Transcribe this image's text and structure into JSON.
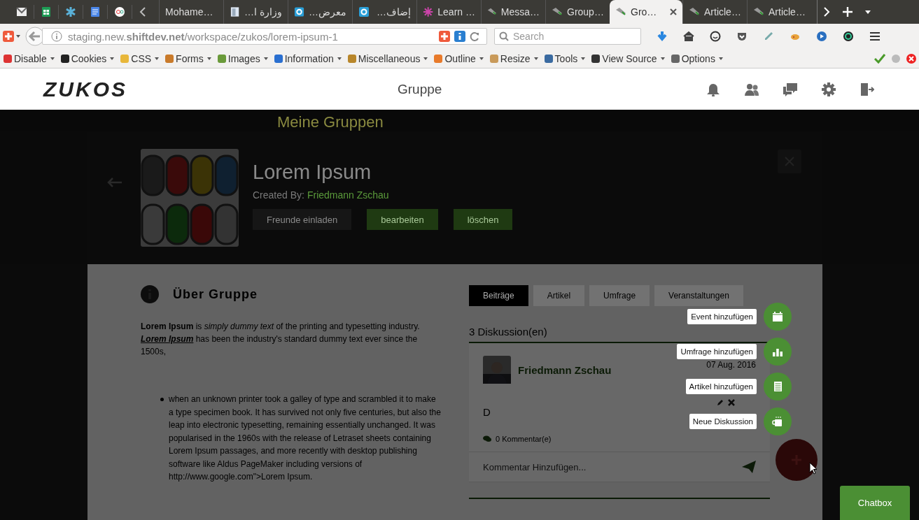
{
  "browser": {
    "pinned_tabs": [
      {
        "kind": "mail"
      },
      {
        "kind": "sheet"
      },
      {
        "kind": "asterisk"
      },
      {
        "kind": "docs"
      },
      {
        "kind": "olx"
      }
    ],
    "tabs": [
      {
        "label": "Mohame…",
        "kind": "none",
        "selected": false
      },
      {
        "label": "وزارة ا…",
        "kind": "doc",
        "selected": false
      },
      {
        "label": "معرض…",
        "kind": "circle",
        "selected": false
      },
      {
        "label": "إضاف…",
        "kind": "circle",
        "selected": false
      },
      {
        "label": "Learn …",
        "kind": "star",
        "selected": false
      },
      {
        "label": "Messa…",
        "kind": "site",
        "selected": false
      },
      {
        "label": "Group…",
        "kind": "site",
        "selected": false
      },
      {
        "label": "Gro…",
        "kind": "site",
        "selected": true
      },
      {
        "label": "Article…",
        "kind": "site",
        "selected": false
      },
      {
        "label": "Article…",
        "kind": "site",
        "selected": false
      }
    ],
    "url": "staging.new.**shiftdev.net**/workspace/zukos/lorem-ipsum-1",
    "search": {
      "placeholder": "Search"
    },
    "dev_toolbar": [
      "Disable",
      "Cookies",
      "CSS",
      "Forms",
      "Images",
      "Information",
      "Miscellaneous",
      "Outline",
      "Resize",
      "Tools",
      "View Source",
      "Options"
    ]
  },
  "app": {
    "logo": "ZUKOS",
    "title": "Gruppe"
  },
  "background_heading": "Meine Gruppen",
  "group": {
    "title": "Lorem Ipsum",
    "created_by_label": "Created By:",
    "creator": "Friedmann Zschau",
    "buttons": [
      {
        "label": "Freunde einladen",
        "kind": "plain"
      },
      {
        "label": "bearbeiten",
        "kind": "green"
      },
      {
        "label": "löschen",
        "kind": "green"
      }
    ]
  },
  "about": {
    "heading": "Über Gruppe",
    "intro": "**Lorem Ipsum** is *simply dummy text* of the printing and typesetting industry.",
    "link": "Lorem Ipsum",
    "after_link": "has been the industry's standard dummy text ever since the 1500s,",
    "bullets": [
      "when an unknown printer took a galley of type and scrambled it to make a type specimen book. It has survived not only five centuries, but also the leap into electronic typesetting, remaining essentially unchanged. It was popularised in the 1960s with the release of Letraset sheets containing Lorem Ipsum passages, and more recently with desktop publishing software like Aldus PageMaker including versions of http://www.google.com\">Lorem Ipsum."
    ]
  },
  "feed": {
    "tabs": [
      {
        "label": "Beiträge",
        "selected": true
      },
      {
        "label": "Artikel",
        "selected": false
      },
      {
        "label": "Umfrage",
        "selected": false
      },
      {
        "label": "Veranstaltungen",
        "selected": false
      }
    ],
    "count": "3 Diskussion(en)",
    "post": {
      "author": "Friedmann Zschau",
      "date": "07 Aug. 2016",
      "body": "D",
      "comments": "0 Kommentar(e)",
      "comment_placeholder": "Kommentar Hinzufügen..."
    }
  },
  "fab_menu": {
    "items": [
      {
        "label": "Event hinzufügen",
        "kind": "calendar"
      },
      {
        "label": "Umfrage hinzufügen",
        "kind": "chart"
      },
      {
        "label": "Artikel hinzufügen",
        "kind": "document"
      },
      {
        "label": "Neue Diskussion",
        "kind": "mug"
      }
    ]
  },
  "chat": {
    "label": "Chatbox"
  }
}
